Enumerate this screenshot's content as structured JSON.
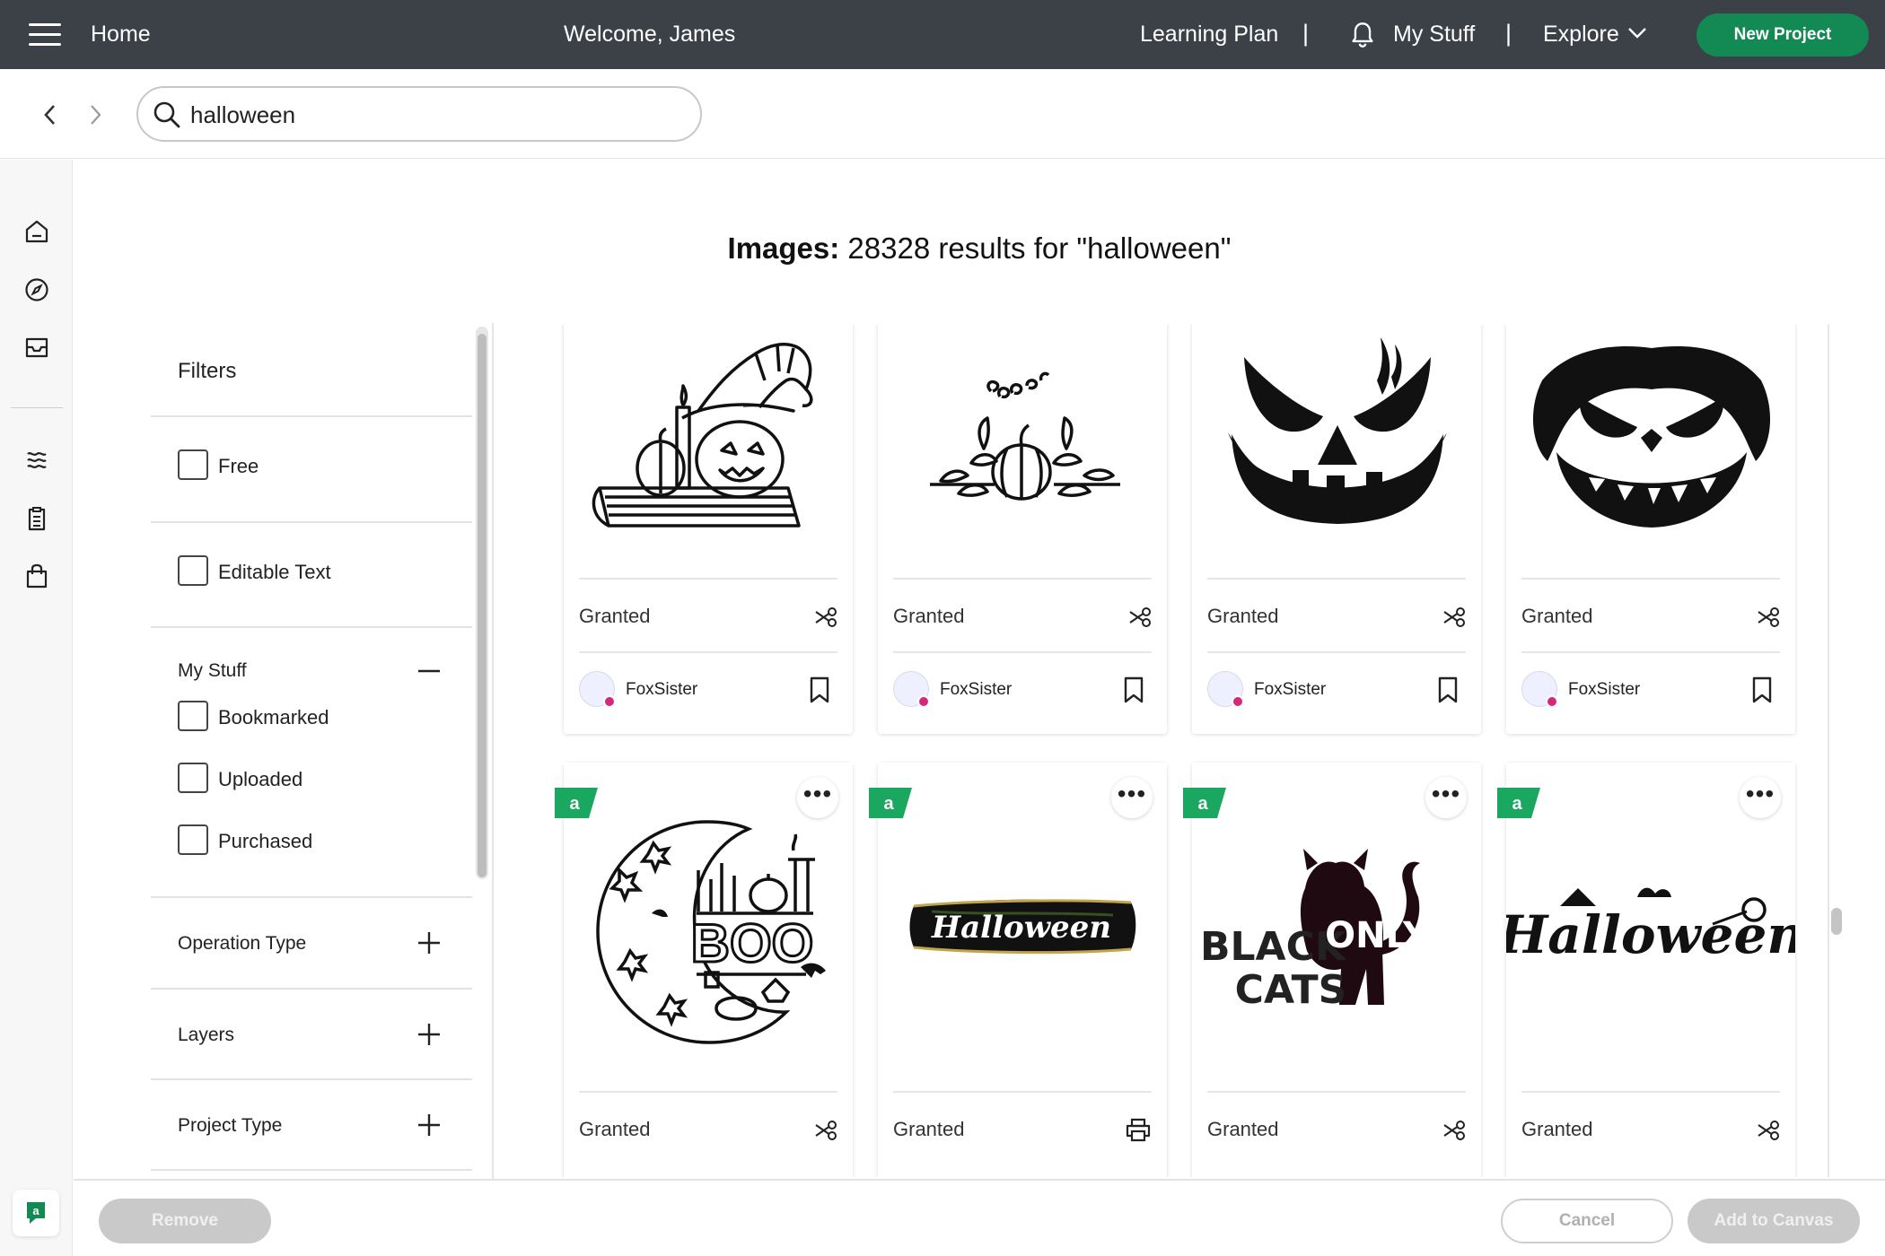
{
  "topbar": {
    "home": "Home",
    "welcome": "Welcome, James",
    "learning_plan": "Learning Plan",
    "sep": "|",
    "my_stuff": "My Stuff",
    "explore": "Explore",
    "new_project": "New Project"
  },
  "search": {
    "value": "halloween"
  },
  "results": {
    "label": "Images:",
    "text": "28328 results for \"halloween\""
  },
  "filters": {
    "title": "Filters",
    "free": "Free",
    "editable_text": "Editable Text",
    "my_stuff": "My Stuff",
    "bookmarked": "Bookmarked",
    "uploaded": "Uploaded",
    "purchased": "Purchased",
    "operation_type": "Operation Type",
    "layers": "Layers",
    "project_type": "Project Type"
  },
  "cards_row1": [
    {
      "status": "Granted",
      "owner": "FoxSister",
      "op": "cut"
    },
    {
      "status": "Granted",
      "owner": "FoxSister",
      "op": "cut"
    },
    {
      "status": "Granted",
      "owner": "FoxSister",
      "op": "cut"
    },
    {
      "status": "Granted",
      "owner": "FoxSister",
      "op": "cut"
    }
  ],
  "cards_row2": [
    {
      "status": "Granted",
      "op": "cut",
      "badge": "a",
      "more": "•••"
    },
    {
      "status": "Granted",
      "op": "print",
      "badge": "a",
      "more": "•••"
    },
    {
      "status": "Granted",
      "op": "cut",
      "badge": "a",
      "more": "•••",
      "art_text_1": "BLACK",
      "art_text_2": "CATS",
      "art_text_3": "ONLY"
    },
    {
      "status": "Granted",
      "op": "cut",
      "badge": "a",
      "more": "•••"
    }
  ],
  "art": {
    "boo": "BOO",
    "halloween_banner": "Halloween",
    "halloween_script": "Halloween"
  },
  "bottom": {
    "remove": "Remove",
    "cancel": "Cancel",
    "add": "Add to Canvas"
  },
  "colors": {
    "topbar": "#3c4148",
    "brand_green": "#138a53",
    "disabled": "#c9c9c9"
  }
}
